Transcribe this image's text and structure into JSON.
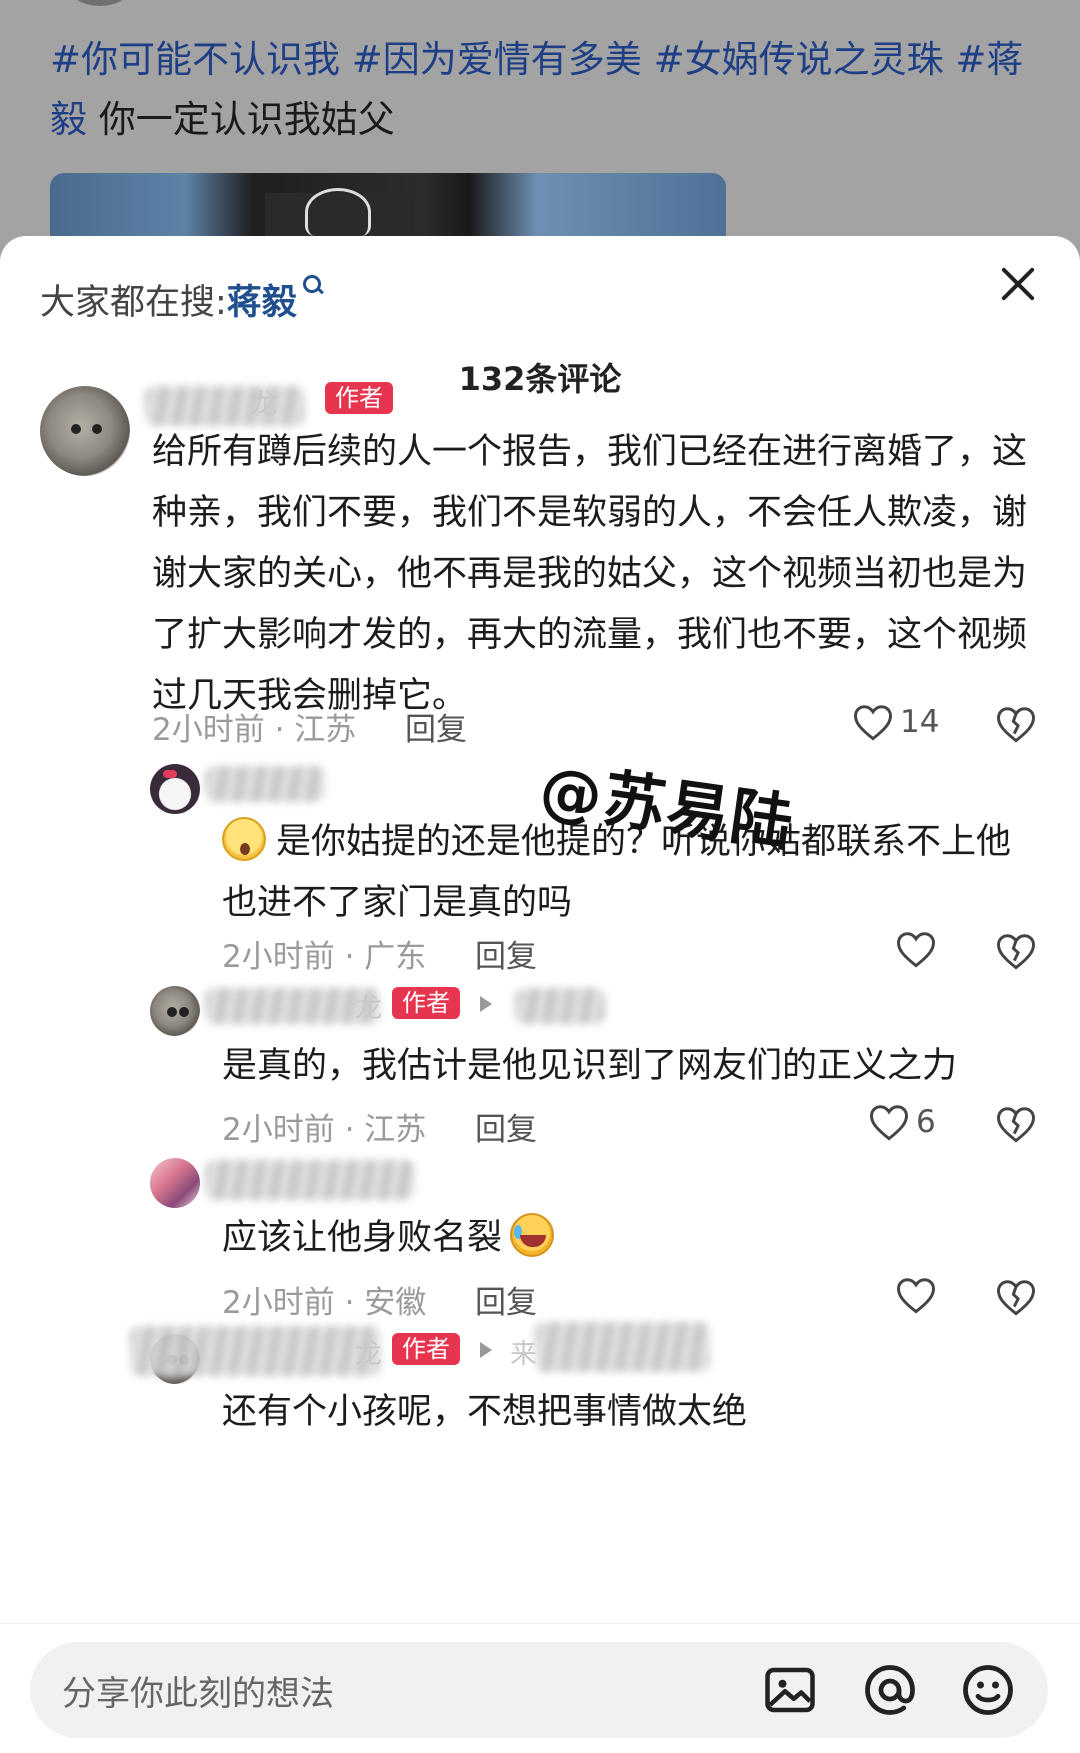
{
  "post": {
    "tags": [
      "#你可能不认识我",
      "#因为爱情有多美",
      "#女娲传说之灵珠",
      "#蒋"
    ],
    "tail_tag": "毅",
    "text": "你一定认识我姑父"
  },
  "sheet": {
    "search_prefix": "大家都在搜:",
    "search_keyword": "蒋毅",
    "comment_count": "132条评论"
  },
  "comments": [
    {
      "name_visible": "龙",
      "badge": "作者",
      "text": "给所有蹲后续的人一个报告，我们已经在进行离婚了，这种亲，我们不要，我们不是软弱的人，不会任人欺凌，谢谢大家的关心，他不再是我的姑父，这个视频当初也是为了扩大影响才发的，再大的流量，我们也不要，这个视频过几天我会删掉它。",
      "meta": "2小时前 · 江苏",
      "reply": "回复",
      "likes": "14"
    },
    {
      "text": "是你姑提的还是他提的？听说你姑都联系不上他 也进不了家门是真的吗",
      "meta": "2小时前 · 广东",
      "reply": "回复",
      "likes": ""
    },
    {
      "name_visible": "龙",
      "badge": "作者",
      "text": "是真的，我估计是他见识到了网友们的正义之力",
      "meta": "2小时前 · 江苏",
      "reply": "回复",
      "likes": "6"
    },
    {
      "text": "应该让他身败名裂",
      "meta": "2小时前 · 安徽",
      "reply": "回复",
      "likes": ""
    },
    {
      "name_visible": "龙",
      "badge": "作者",
      "reply_to_visible": "来",
      "text": "还有个小孩呢，不想把事情做太绝"
    }
  ],
  "watermark": "@苏易陆",
  "input": {
    "placeholder": "分享你此刻的想法"
  },
  "icons": [
    "close-icon",
    "search-icon",
    "heart-icon",
    "dislike-heart-icon",
    "image-icon",
    "at-icon",
    "emoji-icon"
  ],
  "colors": {
    "tag": "#1e3f86",
    "keyword": "#1f4f8f",
    "author_badge": "#e8354f"
  }
}
